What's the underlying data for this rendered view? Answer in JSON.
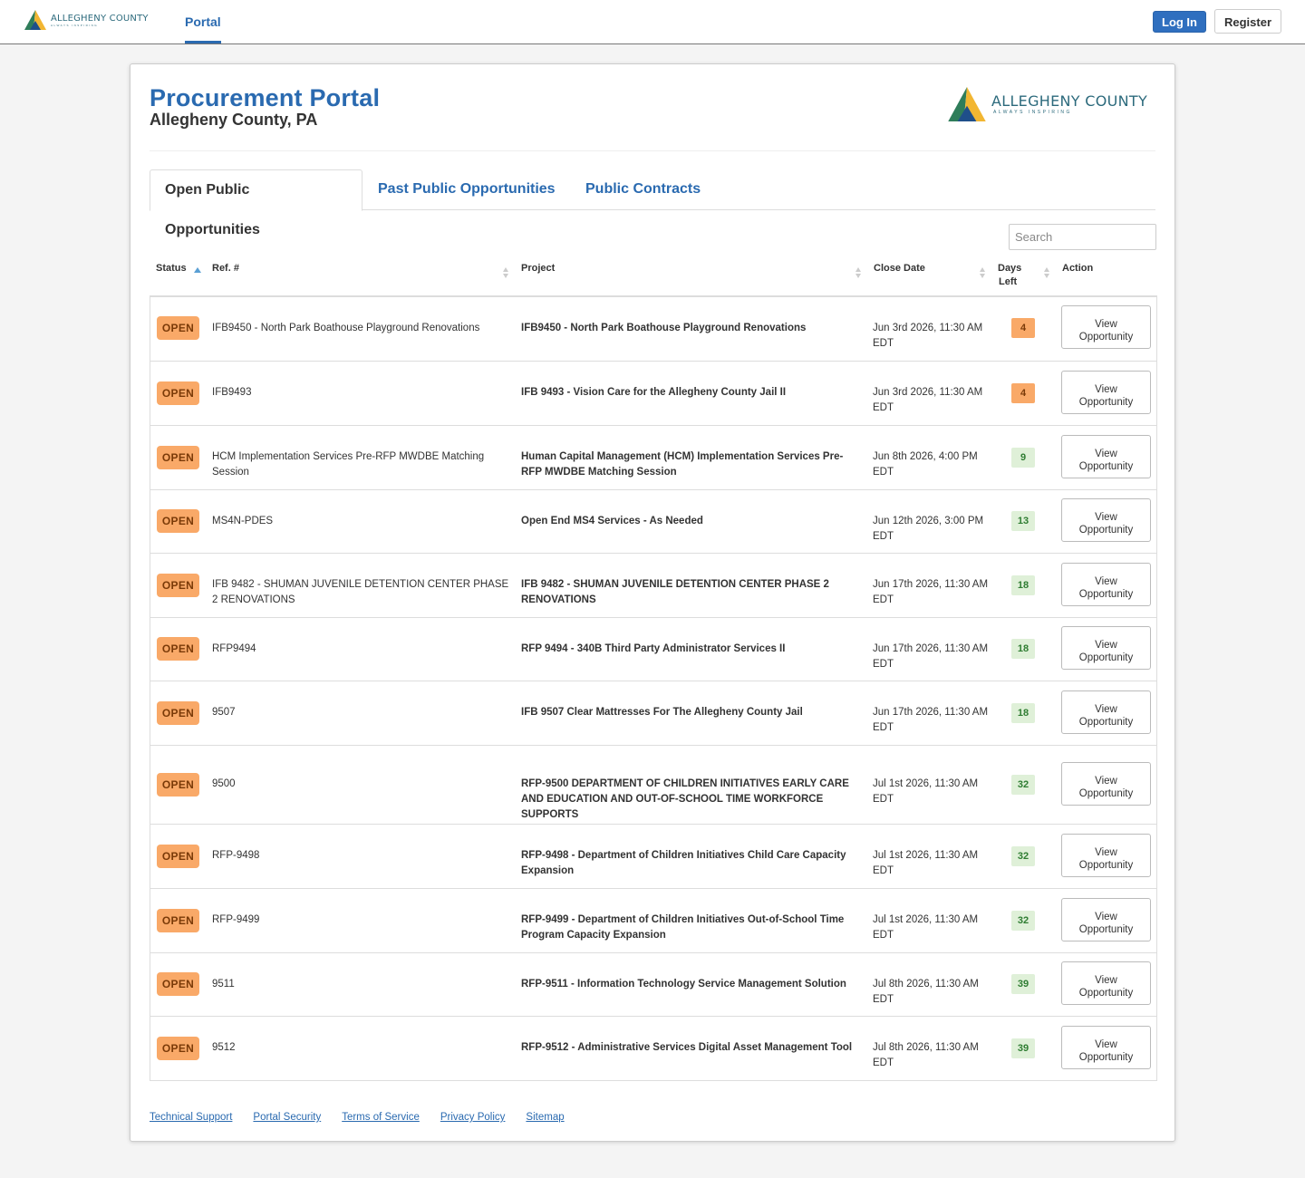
{
  "nav": {
    "logo_name": "ALLEGHENY COUNTY",
    "logo_tagline": "ALWAYS INSPIRING",
    "tab_label": "Portal",
    "login_label": "Log In",
    "register_label": "Register"
  },
  "header": {
    "title": "Procurement Portal",
    "subtitle": "Allegheny County, PA",
    "logo_name": "ALLEGHENY COUNTY",
    "logo_tagline": "ALWAYS INSPIRING"
  },
  "tabs": [
    {
      "label": "Open Public Opportunities",
      "active": true
    },
    {
      "label": "Past Public Opportunities",
      "active": false
    },
    {
      "label": "Public Contracts",
      "active": false
    }
  ],
  "search": {
    "placeholder": "Search",
    "value": ""
  },
  "table": {
    "columns": [
      "Status",
      "Ref. #",
      "Project",
      "Close Date",
      "Days Left",
      "Action"
    ],
    "days_left_lines": [
      "Days",
      "Left"
    ],
    "status_label": "OPEN",
    "action_line1": "View",
    "action_line2": "Opportunity",
    "rows": [
      {
        "ref": "IFB9450 - North Park Boathouse Playground Renovations",
        "project": "IFB9450 - North Park Boathouse Playground Renovations",
        "close": "Jun 3rd 2026, 11:30 AM EDT",
        "days": "4",
        "level": "warn"
      },
      {
        "ref": "IFB9493",
        "project": "IFB 9493 - Vision Care for the Allegheny County Jail II",
        "close": "Jun 3rd 2026, 11:30 AM EDT",
        "days": "4",
        "level": "warn"
      },
      {
        "ref": "HCM Implementation Services Pre-RFP MWDBE Matching Session",
        "project": "Human Capital Management (HCM) Implementation Services Pre-RFP MWDBE Matching Session",
        "close": "Jun 8th 2026, 4:00 PM EDT",
        "days": "9",
        "level": "ok"
      },
      {
        "ref": "MS4N-PDES",
        "project": "Open End MS4 Services - As Needed",
        "close": "Jun 12th 2026, 3:00 PM EDT",
        "days": "13",
        "level": "ok"
      },
      {
        "ref": "IFB 9482 - SHUMAN JUVENILE DETENTION CENTER PHASE 2 RENOVATIONS",
        "project": "IFB 9482 - SHUMAN JUVENILE DETENTION CENTER PHASE 2 RENOVATIONS",
        "close": "Jun 17th 2026, 11:30 AM EDT",
        "days": "18",
        "level": "ok"
      },
      {
        "ref": "RFP9494",
        "project": "RFP 9494 - 340B Third Party Administrator Services II",
        "close": "Jun 17th 2026, 11:30 AM EDT",
        "days": "18",
        "level": "ok"
      },
      {
        "ref": "9507",
        "project": "IFB 9507 Clear Mattresses For The Allegheny County Jail",
        "close": "Jun 17th 2026, 11:30 AM EDT",
        "days": "18",
        "level": "ok"
      },
      {
        "ref": "9500",
        "project": "RFP-9500 DEPARTMENT OF CHILDREN INITIATIVES EARLY CARE AND EDUCATION AND OUT-OF-SCHOOL TIME WORKFORCE SUPPORTS",
        "close": "Jul 1st 2026, 11:30 AM EDT",
        "days": "32",
        "level": "ok"
      },
      {
        "ref": "RFP-9498",
        "project": "RFP-9498 - Department of Children Initiatives Child Care Capacity Expansion",
        "close": "Jul 1st 2026, 11:30 AM EDT",
        "days": "32",
        "level": "ok"
      },
      {
        "ref": "RFP-9499",
        "project": "RFP-9499 - Department of Children Initiatives Out-of-School Time Program Capacity Expansion",
        "close": "Jul 1st 2026, 11:30 AM EDT",
        "days": "32",
        "level": "ok"
      },
      {
        "ref": "9511",
        "project": "RFP-9511 - Information Technology Service Management Solution",
        "close": "Jul 8th 2026, 11:30 AM EDT",
        "days": "39",
        "level": "ok"
      },
      {
        "ref": "9512",
        "project": "RFP-9512 - Administrative Services Digital Asset Management Tool",
        "close": "Jul 8th 2026, 11:30 AM EDT",
        "days": "39",
        "level": "ok"
      }
    ]
  },
  "footer": {
    "links": [
      "Technical Support",
      "Portal Security",
      "Terms of Service",
      "Privacy Policy",
      "Sitemap"
    ]
  },
  "colors": {
    "brand_blue": "#2a6ab0",
    "open_badge": "#f9a968",
    "days_ok_bg": "#dff0d8",
    "days_ok_text": "#2f7d32"
  }
}
